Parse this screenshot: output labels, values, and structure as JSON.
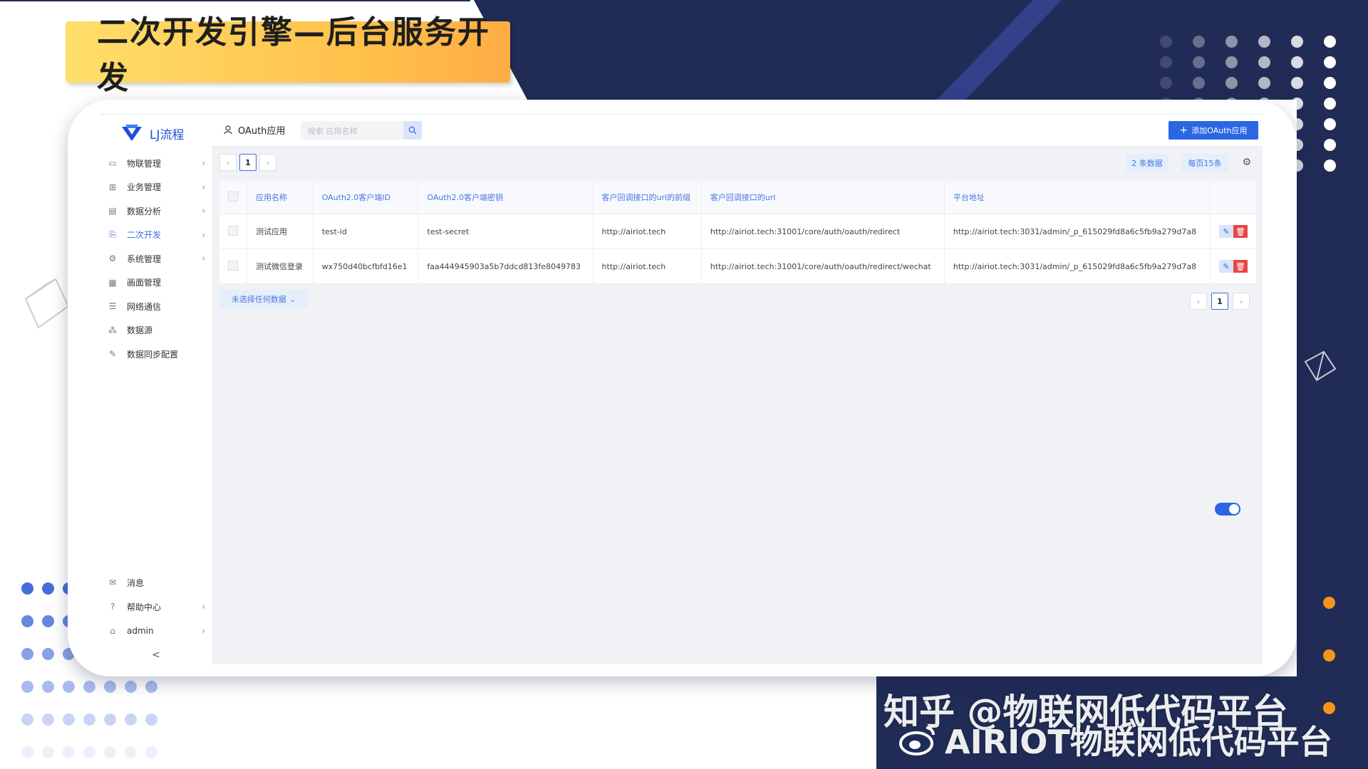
{
  "slide": {
    "title": "二次开发引擎—后台服务开发"
  },
  "app": {
    "logo_text": "LJ流程",
    "sidebar": {
      "items": [
        {
          "label": "物联管理",
          "icon": "monitor-icon",
          "has_arrow": true
        },
        {
          "label": "业务管理",
          "icon": "grid-icon",
          "has_arrow": true
        },
        {
          "label": "数据分析",
          "icon": "chart-icon",
          "has_arrow": true
        },
        {
          "label": "二次开发",
          "icon": "code-edit-icon",
          "has_arrow": true,
          "active": true
        },
        {
          "label": "系统管理",
          "icon": "settings-icon",
          "has_arrow": true
        },
        {
          "label": "画面管理",
          "icon": "building-icon",
          "has_arrow": false
        },
        {
          "label": "网络通信",
          "icon": "document-icon",
          "has_arrow": false
        },
        {
          "label": "数据源",
          "icon": "nodes-icon",
          "has_arrow": false
        },
        {
          "label": "数据同步配置",
          "icon": "edit-icon",
          "has_arrow": false
        }
      ],
      "bottom": [
        {
          "label": "消息",
          "icon": "message-icon",
          "has_arrow": false
        },
        {
          "label": "帮助中心",
          "icon": "help-icon",
          "has_arrow": true
        },
        {
          "label": "admin",
          "icon": "user-lock-icon",
          "has_arrow": true
        }
      ],
      "collapse_glyph": "<"
    },
    "header": {
      "page_title": "OAuth应用",
      "search_placeholder": "搜索 应用名称",
      "add_button": "添加OAuth应用"
    },
    "pagination": {
      "current_page": "1",
      "count_label": "2 条数据",
      "per_page_label": "每页15条"
    },
    "table": {
      "columns": [
        "应用名称",
        "OAuth2.0客户端ID",
        "OAuth2.0客户端密钥",
        "客户回调接口的url的前缀",
        "客户回调接口的url",
        "平台地址"
      ],
      "rows": [
        [
          "测试应用",
          "test-id",
          "test-secret",
          "http://airiot.tech",
          "http://airiot.tech:31001/core/auth/oauth/redirect",
          "http://airiot.tech:3031/admin/_p_615029fd8a6c5fb9a279d7a8"
        ],
        [
          "测试微信登录",
          "wx750d40bcfbfd16e1",
          "faa444945903a5b7ddcd813fe8049783",
          "http://airiot.tech",
          "http://airiot.tech:31001/core/auth/oauth/redirect/wechat",
          "http://airiot.tech:3031/admin/_p_615029fd8a6c5fb9a279d7a8"
        ]
      ]
    },
    "select_status": "未选择任何数据"
  },
  "watermarks": {
    "zhihu": "知乎 @物联网低代码平台",
    "weibo": "AIRIOT物联网低代码平台"
  },
  "colors": {
    "navy": "#212c56",
    "accent_blue": "#2b66e3",
    "banner_yellow": "#ffd15c",
    "orange_dot": "#f7941d",
    "delete_red": "#e54747"
  }
}
